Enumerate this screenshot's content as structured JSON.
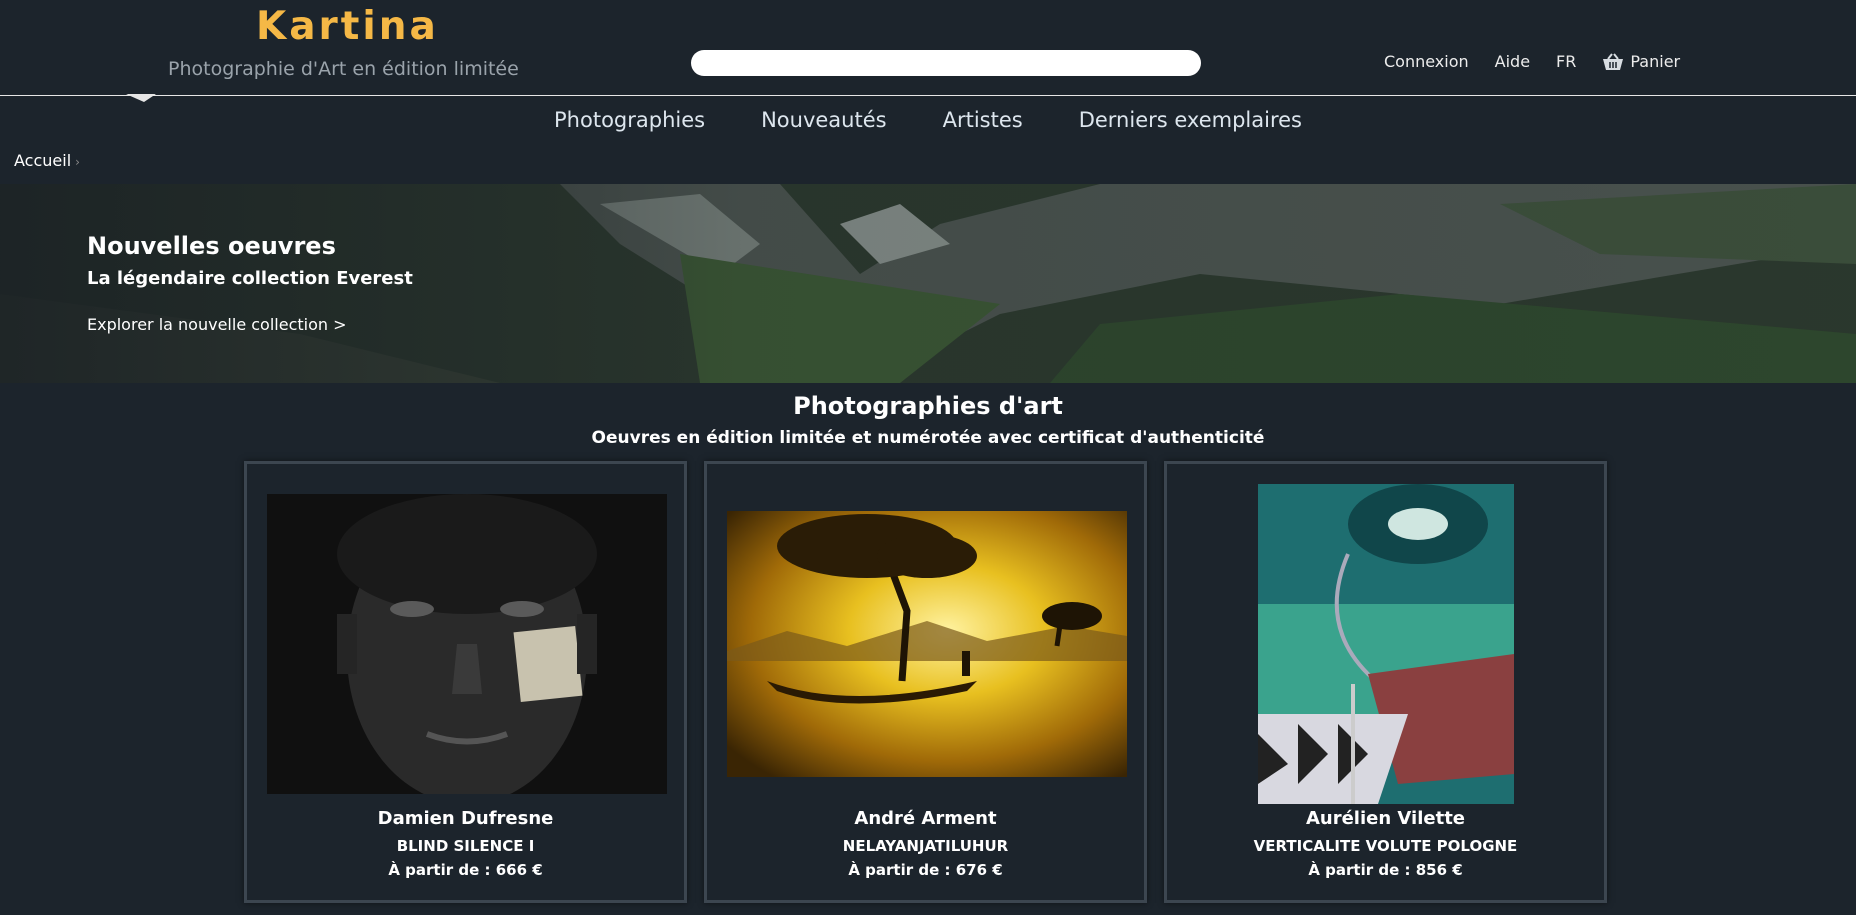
{
  "header": {
    "logo": "Kartina",
    "tagline": "Photographie d'Art en édition limitée",
    "search_placeholder": "",
    "links": [
      "Connexion",
      "Aide",
      "FR"
    ],
    "cart_label": "Panier"
  },
  "nav": [
    "Photographies",
    "Nouveautés",
    "Artistes",
    "Derniers exemplaires"
  ],
  "breadcrumb": "Accueil",
  "banner": {
    "title": "Nouvelles oeuvres",
    "subtitle": "La légendaire collection Everest",
    "cta": "Explorer la nouvelle collection >"
  },
  "section": {
    "title": "Photographies d'art",
    "subtitle": "Oeuvres en édition limitée et numérotée avec certificat d'authenticité"
  },
  "cards": [
    {
      "artist": "Damien Dufresne",
      "title": "BLIND SILENCE I",
      "price": "À partir de : 666 €"
    },
    {
      "artist": "André Arment",
      "title": "NELAYANJATILUHUR",
      "price": "À partir de : 676 €"
    },
    {
      "artist": "Aurélien Vilette",
      "title": "VERTICALITE VOLUTE POLOGNE",
      "price": "À partir de : 856 €"
    }
  ]
}
